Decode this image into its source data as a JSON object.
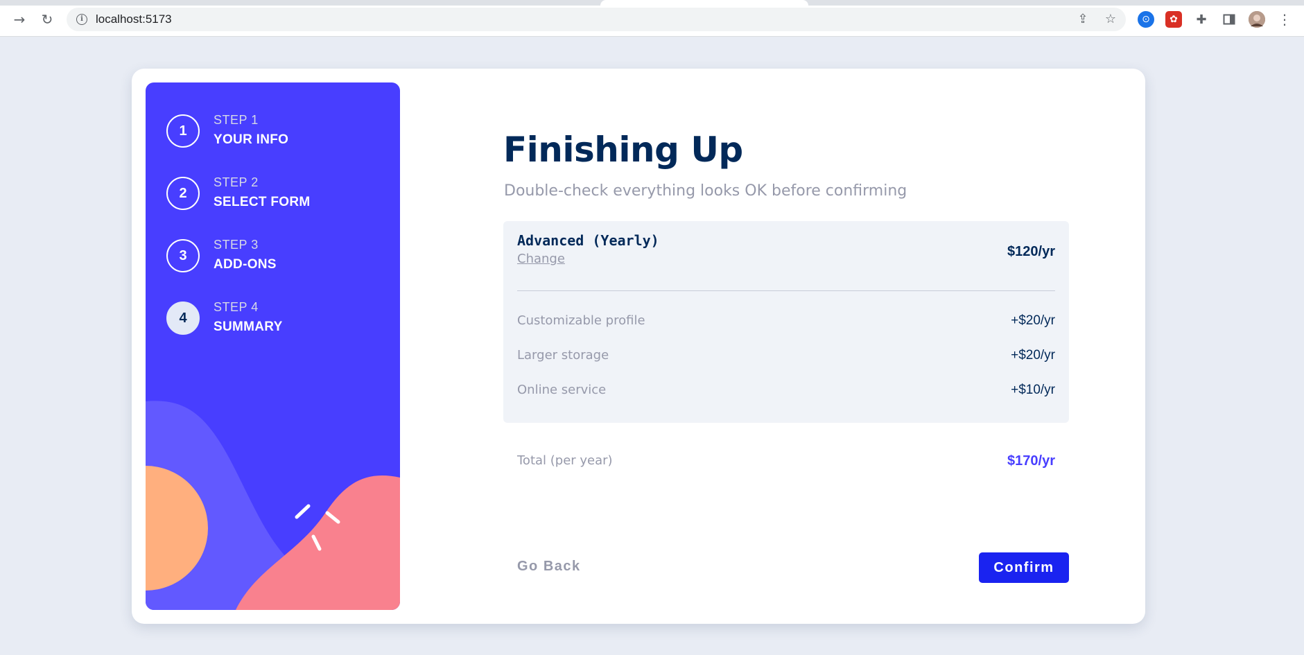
{
  "browser": {
    "url": "localhost:5173",
    "icons": [
      "forward-icon",
      "reload-icon",
      "info-icon",
      "share-icon",
      "star-icon",
      "extension-icon",
      "puzzle-icon",
      "sidepanel-icon",
      "avatar",
      "menu-icon"
    ]
  },
  "sidebar": {
    "steps": [
      {
        "number": "1",
        "step_label": "STEP 1",
        "title": "YOUR INFO",
        "active": false
      },
      {
        "number": "2",
        "step_label": "STEP 2",
        "title": "SELECT FORM",
        "active": false
      },
      {
        "number": "3",
        "step_label": "STEP 3",
        "title": "ADD-ONS",
        "active": false
      },
      {
        "number": "4",
        "step_label": "STEP 4",
        "title": "SUMMARY",
        "active": true
      }
    ]
  },
  "main": {
    "title": "Finishing Up",
    "subtitle": "Double-check everything looks OK before confirming",
    "plan": {
      "name": "Advanced (Yearly)",
      "change_label": "Change",
      "price": "$120/yr"
    },
    "addons": [
      {
        "name": "Customizable profile",
        "price": "+$20/yr"
      },
      {
        "name": "Larger storage",
        "price": "+$20/yr"
      },
      {
        "name": "Online service",
        "price": "+$10/yr"
      }
    ],
    "total": {
      "label": "Total (per year)",
      "value": "$170/yr"
    },
    "buttons": {
      "back": "Go Back",
      "confirm": "Confirm"
    }
  },
  "colors": {
    "sidebar_bg": "#483eff",
    "accent": "#483eff",
    "confirm_bg": "#1a23f0",
    "denim": "#022959",
    "grey": "#9699aa",
    "page_bg": "#e8ecf4"
  }
}
